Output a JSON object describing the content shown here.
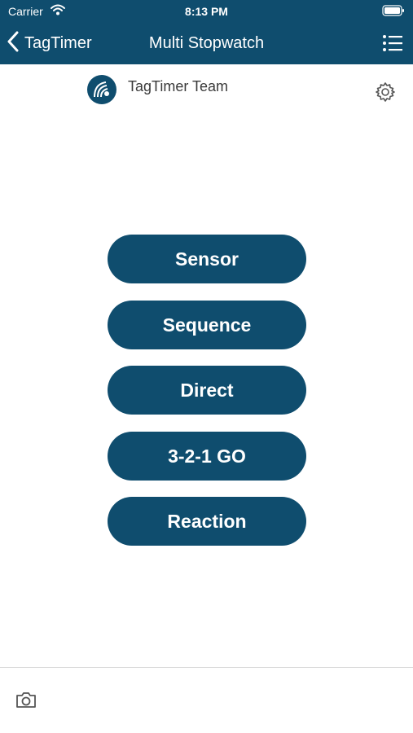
{
  "status_bar": {
    "carrier": "Carrier",
    "time": "8:13 PM"
  },
  "nav": {
    "back_label": "TagTimer",
    "title": "Multi Stopwatch"
  },
  "team": {
    "name": "TagTimer Team"
  },
  "modes": [
    "Sensor",
    "Sequence",
    "Direct",
    "3-2-1 GO",
    "Reaction"
  ],
  "icons": {
    "back": "chevron-left-icon",
    "menu": "list-icon",
    "settings": "gear-icon",
    "camera": "camera-icon",
    "wifi": "wifi-icon",
    "battery": "battery-icon"
  },
  "colors": {
    "brand": "#0f4d6e",
    "background": "#ffffff"
  }
}
